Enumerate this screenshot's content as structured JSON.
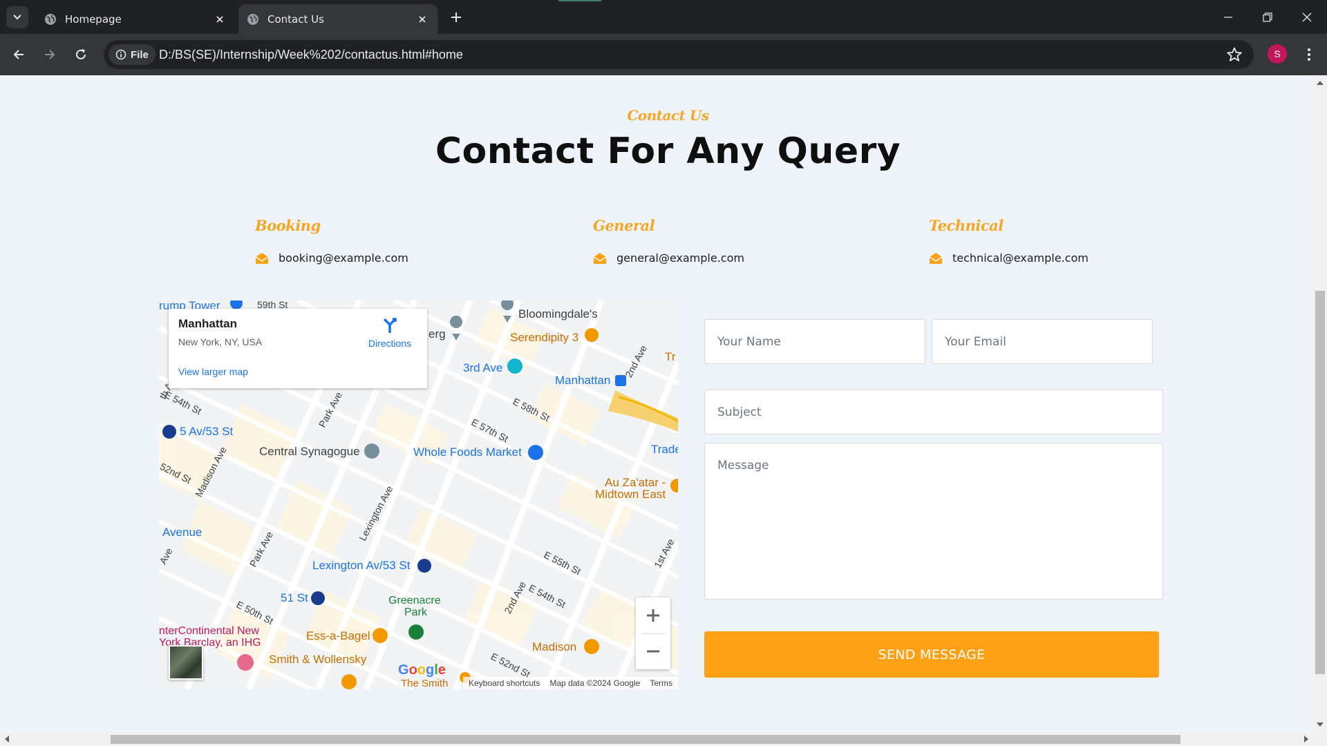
{
  "browser": {
    "tabs": [
      {
        "title": "Homepage",
        "active": false,
        "icon": "globe-icon"
      },
      {
        "title": "Contact Us",
        "active": true,
        "icon": "globe-icon"
      }
    ],
    "site_chip": "File",
    "url": "D:/BS(SE)/Internship/Week%202/contactus.html#home",
    "profile_initial": "S"
  },
  "section": {
    "eyebrow": "Contact Us",
    "heading": "Contact For Any Query"
  },
  "contacts": [
    {
      "label": "Booking",
      "email": "booking@example.com",
      "icon": "envelope-open-icon"
    },
    {
      "label": "General",
      "email": "general@example.com",
      "icon": "envelope-open-icon"
    },
    {
      "label": "Technical",
      "email": "technical@example.com",
      "icon": "envelope-open-icon"
    }
  ],
  "map": {
    "place": "Manhattan",
    "address": "New York, NY, USA",
    "directions": "Directions",
    "view_larger": "View larger map",
    "labels": {
      "trump_tower": "rump Tower",
      "bloomingdales": "Bloomingdale's",
      "serendipity": "Serendipity 3",
      "third_ave": "3rd Ave",
      "manhattan": "Manhattan",
      "five_av": "5 Av/53 St",
      "central_synagogue": "Central Synagogue",
      "whole_foods": "Whole Foods Market",
      "au_zaatar_1": "Au Za'atar -",
      "au_zaatar_2": "Midtown East",
      "trade": "Trade",
      "tr": "Tr",
      "avenue": "Avenue",
      "lexington": "Lexington Av/53 St",
      "fifty_one": "51 St",
      "greenacre_1": "Greenacre",
      "greenacre_2": "Park",
      "intercontinental_1": "nterContinental New",
      "intercontinental_2": "York Barclay, an IHG",
      "ess_a_bagel": "Ess-a-Bagel",
      "smith_wollensky": "Smith & Wollensky",
      "madison": "Madison",
      "the_smith": "The Smith",
      "erg": "erg",
      "e59": "59th St",
      "e58": "E 58th St",
      "e57": "E 57th St",
      "e55": "E 55th St",
      "e54": "E 54th St",
      "e54w": "E 54th St",
      "e52": "E 52nd St",
      "e52w": "52nd St",
      "e50": "E 50th St",
      "second_ave_top": "2nd Ave",
      "second_ave": "2nd Ave",
      "first_ave": "1st Ave",
      "park_ave": "Park Ave",
      "park_ave_2": "Park Ave",
      "madison_ave": "Madison Ave",
      "lexington_ave": "Lexington Ave",
      "th_av": "th Av",
      "ave_w": "Ave",
      "st_57": "E 57"
    },
    "attribution": {
      "shortcuts": "Keyboard shortcuts",
      "data": "Map data ©2024 Google",
      "terms": "Terms"
    },
    "logo": "Google"
  },
  "form": {
    "name_placeholder": "Your Name",
    "email_placeholder": "Your Email",
    "subject_placeholder": "Subject",
    "message_placeholder": "Message",
    "send_label": "SEND MESSAGE"
  },
  "colors": {
    "accent": "#fea116",
    "page_bg": "#eef4fa",
    "chrome_dark": "#202124",
    "chrome_toolbar": "#35363a"
  }
}
